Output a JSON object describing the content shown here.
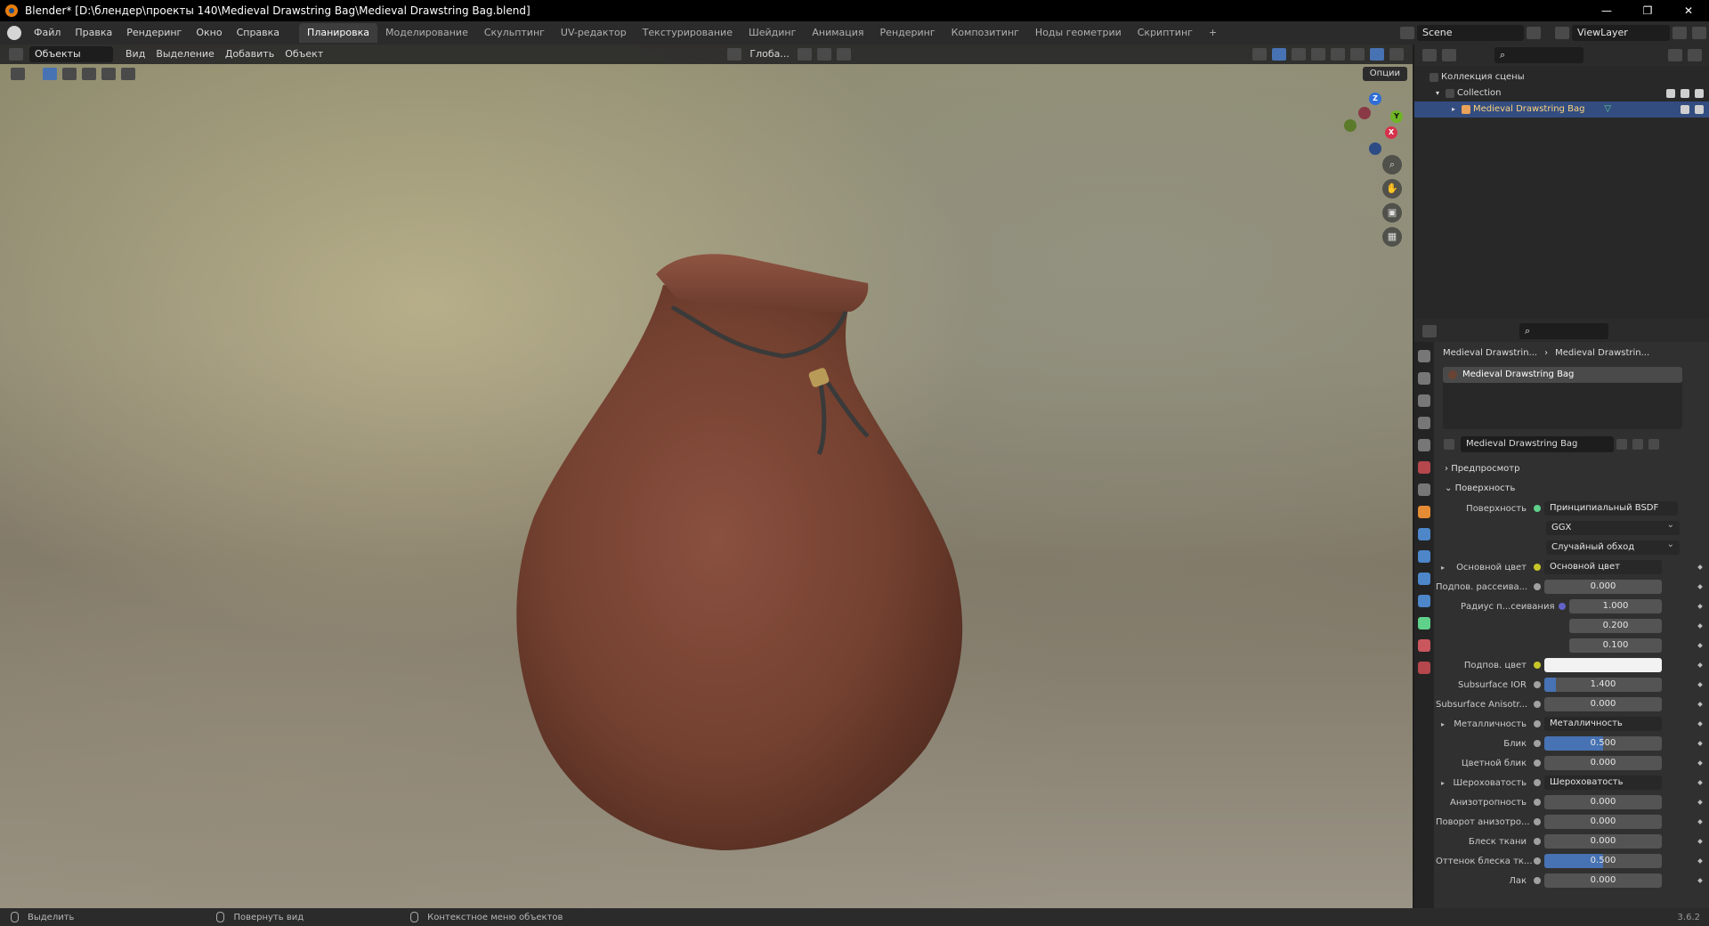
{
  "window": {
    "title": "Blender* [D:\\блендер\\проекты 140\\Medieval Drawstring Bag\\Medieval Drawstring Bag.blend]",
    "controls": [
      "—",
      "❐",
      "✕"
    ]
  },
  "menu": [
    "Файл",
    "Правка",
    "Рендеринг",
    "Окно",
    "Справка"
  ],
  "workspaces": [
    "Планировка",
    "Моделирование",
    "Скульптинг",
    "UV-редактор",
    "Текстурирование",
    "Шейдинг",
    "Анимация",
    "Рендеринг",
    "Композитинг",
    "Ноды геометрии",
    "Скриптинг",
    "+"
  ],
  "active_workspace": "Планировка",
  "scene": {
    "name": "Scene",
    "view_layer": "ViewLayer"
  },
  "viewport": {
    "mode": "Объекты",
    "menus": [
      "Вид",
      "Выделение",
      "Добавить",
      "Объект"
    ],
    "transform_orientation": "Глоба...",
    "options": "Опции",
    "gizmo": {
      "x": "X",
      "y": "Y",
      "z": "Z"
    }
  },
  "outliner": {
    "root": "Коллекция сцены",
    "collection": "Collection",
    "object": "Medieval Drawstring Bag"
  },
  "properties": {
    "breadcrumb_object": "Medieval Drawstrin...",
    "breadcrumb_material": "Medieval Drawstrin...",
    "slot": "Medieval Drawstring Bag",
    "material_name": "Medieval Drawstring Bag",
    "sections": {
      "preview": "Предпросмотр",
      "surface": "Поверхность"
    },
    "surface_label": "Поверхность",
    "surface_shader": "Принципиальный BSDF",
    "distribution": "GGX",
    "subsurface_method": "Случайный обход",
    "rows": [
      {
        "label": "Основной цвет",
        "value": "Основной цвет",
        "kind": "link",
        "dot": "#c7c729",
        "expand": true
      },
      {
        "label": "Подпов. рассеива...",
        "value": "0.000",
        "kind": "num",
        "fill": 0,
        "dot": "#a1a1a1"
      },
      {
        "label": "Радиус п...сеивания",
        "value": "1.000",
        "kind": "num",
        "fill": 0,
        "dot": "#6363c7",
        "indent": true
      },
      {
        "label": "",
        "value": "0.200",
        "kind": "num",
        "fill": 0,
        "dot": "",
        "indent": true
      },
      {
        "label": "",
        "value": "0.100",
        "kind": "num",
        "fill": 0,
        "dot": "",
        "indent": true
      },
      {
        "label": "Подпов. цвет",
        "value": "",
        "kind": "color",
        "dot": "#c7c729"
      },
      {
        "label": "Subsurface IOR",
        "value": "1.400",
        "kind": "num",
        "fill": 0.1,
        "dot": "#a1a1a1"
      },
      {
        "label": "Subsurface Anisotr...",
        "value": "0.000",
        "kind": "num",
        "fill": 0,
        "dot": "#a1a1a1"
      },
      {
        "label": "Металличность",
        "value": "Металличность",
        "kind": "link",
        "dot": "#a1a1a1",
        "expand": true
      },
      {
        "label": "Блик",
        "value": "0.500",
        "kind": "num",
        "fill": 0.5,
        "dot": "#a1a1a1"
      },
      {
        "label": "Цветной блик",
        "value": "0.000",
        "kind": "num",
        "fill": 0,
        "dot": "#a1a1a1"
      },
      {
        "label": "Шероховатость",
        "value": "Шероховатость",
        "kind": "link",
        "dot": "#a1a1a1",
        "expand": true
      },
      {
        "label": "Анизотропность",
        "value": "0.000",
        "kind": "num",
        "fill": 0,
        "dot": "#a1a1a1"
      },
      {
        "label": "Поворот анизотро...",
        "value": "0.000",
        "kind": "num",
        "fill": 0,
        "dot": "#a1a1a1"
      },
      {
        "label": "Блеск ткани",
        "value": "0.000",
        "kind": "num",
        "fill": 0,
        "dot": "#a1a1a1"
      },
      {
        "label": "Оттенок блеска тк...",
        "value": "0.500",
        "kind": "num",
        "fill": 0.5,
        "dot": "#a1a1a1"
      },
      {
        "label": "Лак",
        "value": "0.000",
        "kind": "num",
        "fill": 0,
        "dot": "#a1a1a1"
      }
    ]
  },
  "statusbar": {
    "select": "Выделить",
    "rotate": "Повернуть вид",
    "context": "Контекстное меню объектов",
    "version": "3.6.2"
  },
  "colors": {
    "accent": "#4772b3",
    "selected_row": "#334d80",
    "bag": "#7a4634"
  }
}
